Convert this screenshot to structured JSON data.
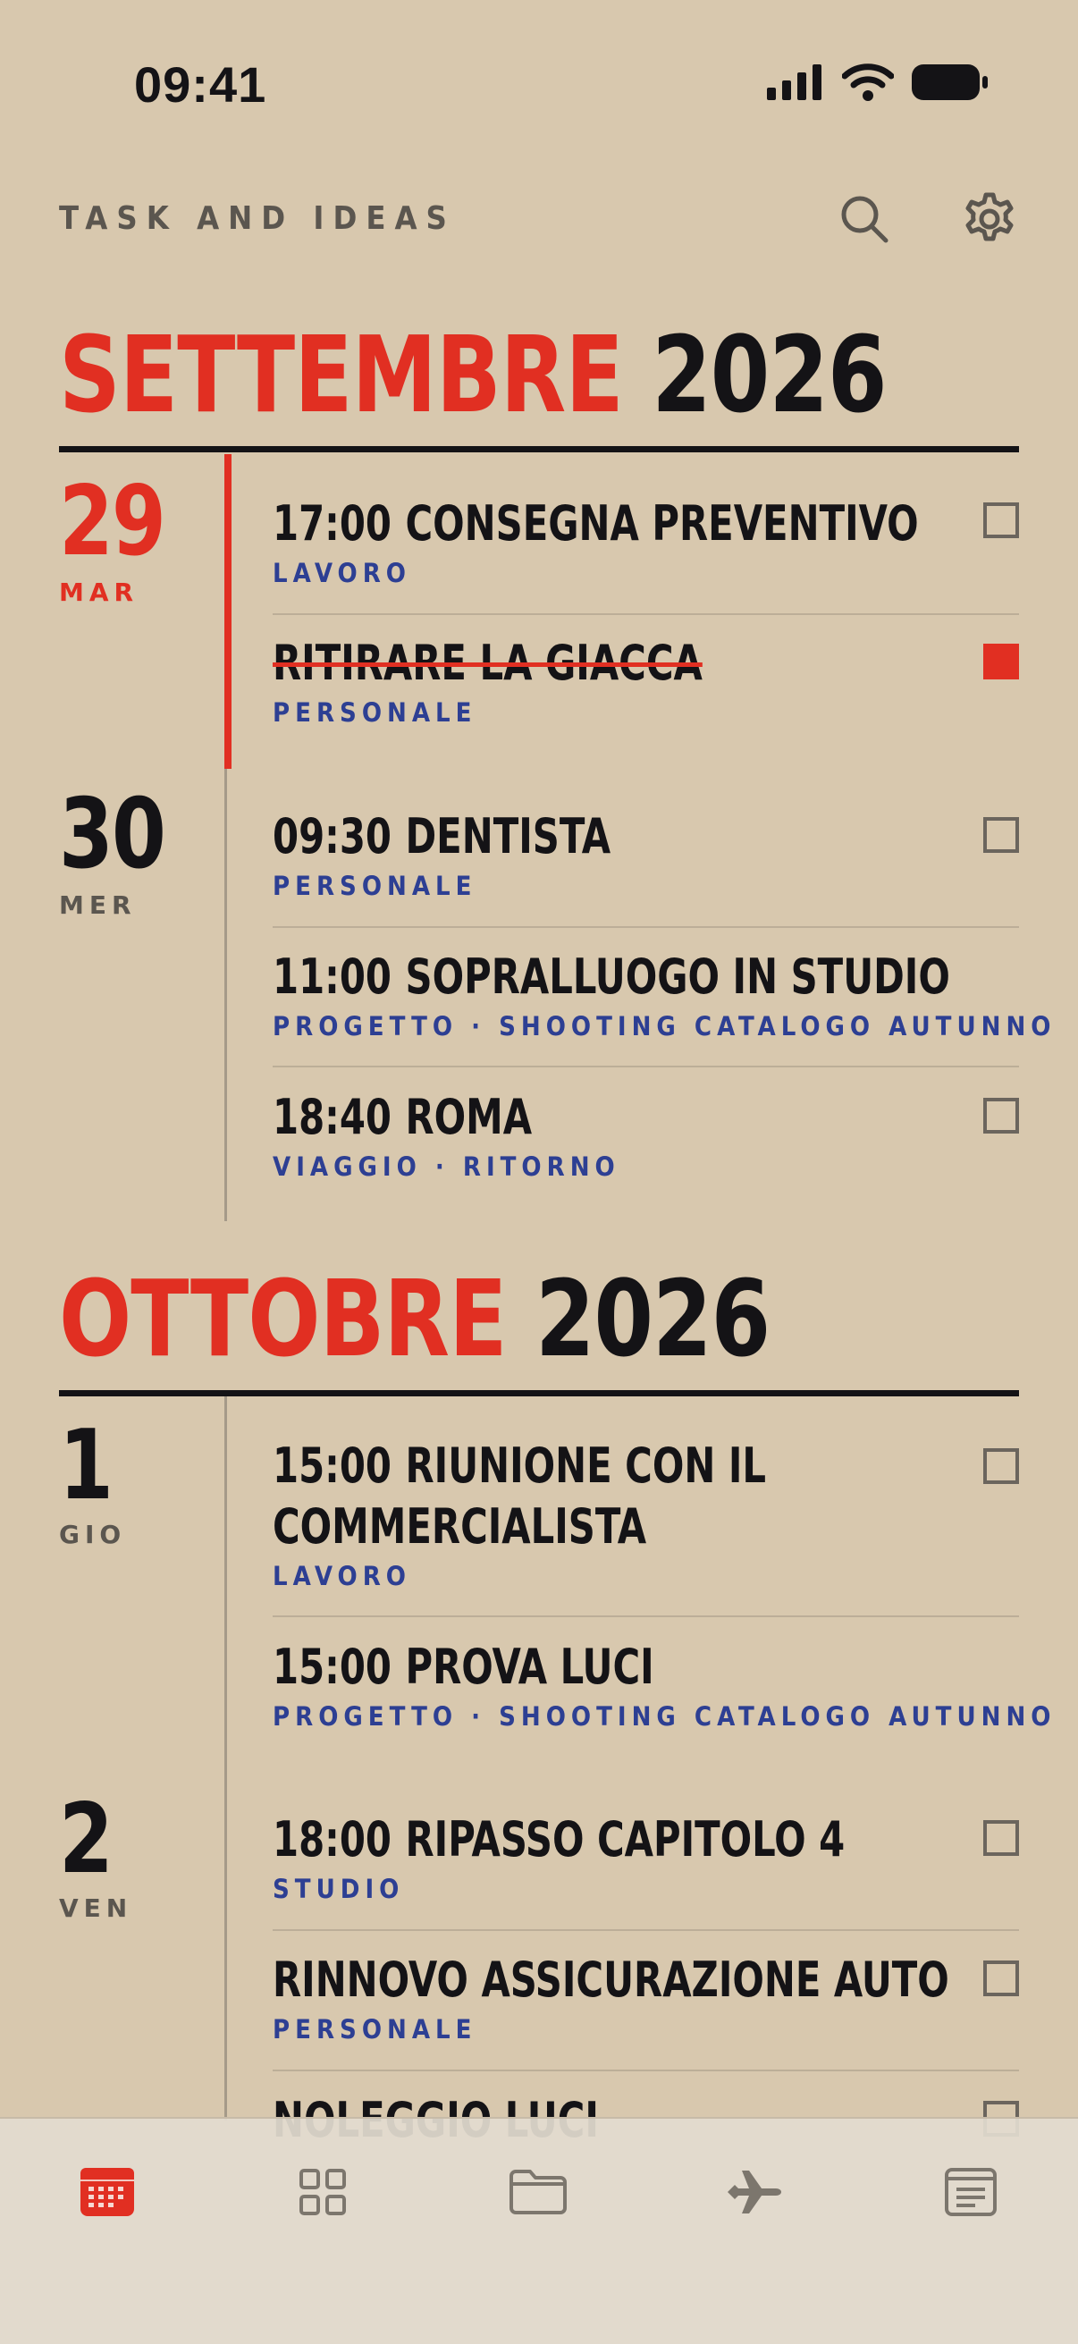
{
  "status_bar": {
    "time": "09:41"
  },
  "header": {
    "title": "TASK AND IDEAS",
    "search_icon": "search-icon",
    "settings_icon": "gear-icon"
  },
  "colors": {
    "accent": "#e12f22",
    "ink": "#141316",
    "category": "#2d3f93",
    "background": "#d8c8ae"
  },
  "months": [
    {
      "name": "SETTEMBRE",
      "year": "2026",
      "days": [
        {
          "day": "29",
          "weekday": "MAR",
          "today": true,
          "tasks": [
            {
              "time": "17:00",
              "title": "CONSEGNA PREVENTIVO",
              "category": "LAVORO",
              "checkbox": true,
              "done": false
            },
            {
              "time": "",
              "title": "RITIRARE LA GIACCA",
              "category": "PERSONALE",
              "checkbox": true,
              "done": true
            }
          ]
        },
        {
          "day": "30",
          "weekday": "MER",
          "tasks": [
            {
              "time": "09:30",
              "title": "DENTISTA",
              "category": "PERSONALE",
              "checkbox": true,
              "done": false
            },
            {
              "time": "11:00",
              "title": "SOPRALLUOGO IN STUDIO",
              "category": "PROGETTO · SHOOTING CATALOGO AUTUNNO",
              "checkbox": false,
              "done": false
            },
            {
              "time": "18:40",
              "title": "ROMA",
              "category": "VIAGGIO · RITORNO",
              "checkbox": true,
              "done": false
            }
          ]
        }
      ]
    },
    {
      "name": "OTTOBRE",
      "year": "2026",
      "days": [
        {
          "day": "1",
          "weekday": "GIO",
          "tasks": [
            {
              "time": "15:00",
              "title": "RIUNIONE CON IL COMMERCIALISTA",
              "category": "LAVORO",
              "checkbox": true,
              "done": false
            },
            {
              "time": "15:00",
              "title": "PROVA LUCI",
              "category": "PROGETTO · SHOOTING CATALOGO AUTUNNO",
              "checkbox": false,
              "done": false
            }
          ]
        },
        {
          "day": "2",
          "weekday": "VEN",
          "tasks": [
            {
              "time": "18:00",
              "title": "RIPASSO CAPITOLO 4",
              "category": "STUDIO",
              "checkbox": true,
              "done": false
            },
            {
              "time": "",
              "title": "RINNOVO ASSICURAZIONE AUTO",
              "category": "PERSONALE",
              "checkbox": true,
              "done": false
            },
            {
              "time": "",
              "title": "NOLEGGIO LUCI",
              "category": "",
              "checkbox": true,
              "done": false
            }
          ]
        }
      ]
    }
  ],
  "tab_bar": {
    "tabs": [
      {
        "icon": "calendar-icon",
        "active": true
      },
      {
        "icon": "grid-icon",
        "active": false
      },
      {
        "icon": "folder-icon",
        "active": false
      },
      {
        "icon": "airplane-icon",
        "active": false
      },
      {
        "icon": "notes-icon",
        "active": false
      }
    ]
  }
}
